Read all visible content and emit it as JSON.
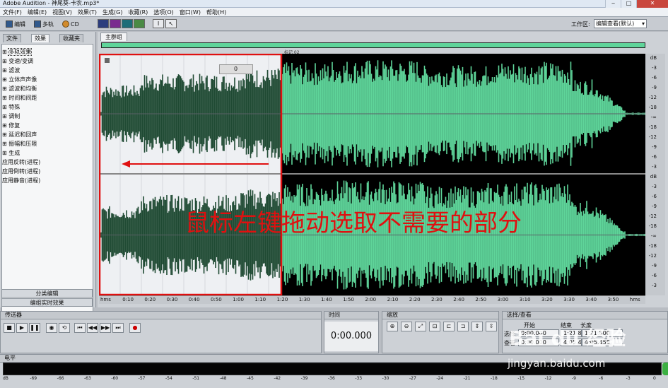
{
  "app": {
    "title": "Adobe Audition - 神尾葵-卡农.mp3*"
  },
  "menu": [
    "文件(F)",
    "编辑(E)",
    "视图(V)",
    "效果(T)",
    "生成(G)",
    "收藏(R)",
    "选项(O)",
    "窗口(W)",
    "帮助(H)"
  ],
  "toolbar": {
    "edit": "编辑",
    "multitrack": "多轨",
    "cd": "CD",
    "workspace_label": "工作区:",
    "workspace_value": "编辑查看(默认)"
  },
  "left_panel": {
    "tabs": [
      "文件",
      "效果",
      "收藏夹"
    ],
    "items": [
      "多轨效果",
      "变速/变调",
      "滤波",
      "立体声声像",
      "滤波和均衡",
      "时间和间距",
      "特殊",
      "调制",
      "修复",
      "延迟和回声",
      "振幅和压限",
      "生成",
      "应用反转(进程)",
      "应用倒转(进程)",
      "应用静音(进程)"
    ],
    "btn_category": "分类编辑",
    "btn_realtime": "编组实时效果"
  },
  "main": {
    "tab": "主群组",
    "marker": "标记 02",
    "level": "0"
  },
  "db_scale_labels": [
    "dB",
    "-3",
    "-6",
    "-9",
    "-12",
    "-18",
    "-∞",
    "-18",
    "-12",
    "-9",
    "-6",
    "-3",
    "dB",
    "-3",
    "-6",
    "-9",
    "-12",
    "-18",
    "-∞",
    "-18",
    "-12",
    "-9",
    "-6",
    "-3"
  ],
  "timeline_labels": [
    "hms",
    "0:10",
    "0:20",
    "0:30",
    "0:40",
    "0:50",
    "1:00",
    "1:10",
    "1:20",
    "1:30",
    "1:40",
    "1:50",
    "2:00",
    "2:10",
    "2:20",
    "2:30",
    "2:40",
    "2:50",
    "3:00",
    "3:10",
    "3:20",
    "3:30",
    "3:40",
    "3:50",
    "hms"
  ],
  "transport": {
    "title": "传送器"
  },
  "time": {
    "title": "时间",
    "value": "0:00.000"
  },
  "zoom": {
    "title": "缩放"
  },
  "selection": {
    "title": "选择/查看",
    "col_start": "开始",
    "col_end": "结束",
    "col_length": "长度",
    "row_select": "选择",
    "row_view": "查看",
    "sel_start": "0:00.000",
    "sel_end": "1:21.800",
    "sel_length": "1:21.800",
    "view_start": "0:00.000",
    "view_end": "4:05.458",
    "view_length": "4:05.458"
  },
  "level_meter": {
    "title": "电平",
    "scale": [
      "dB",
      "-69",
      "-66",
      "-63",
      "-60",
      "-57",
      "-54",
      "-51",
      "-48",
      "-45",
      "-42",
      "-39",
      "-36",
      "-33",
      "-30",
      "-27",
      "-24",
      "-21",
      "-18",
      "-15",
      "-12",
      "-9",
      "-6",
      "-3",
      "0"
    ]
  },
  "annotation": "鼠标左键拖动选取不需要的部分",
  "watermark": {
    "logo": "Bai du 经验",
    "url": "jingyan.baidu.com"
  },
  "colors": {
    "waveform": "#5fd59a",
    "selected_waveform": "#1f4a33",
    "selection_bg": "#eef0f3",
    "annotation": "#e01010"
  }
}
